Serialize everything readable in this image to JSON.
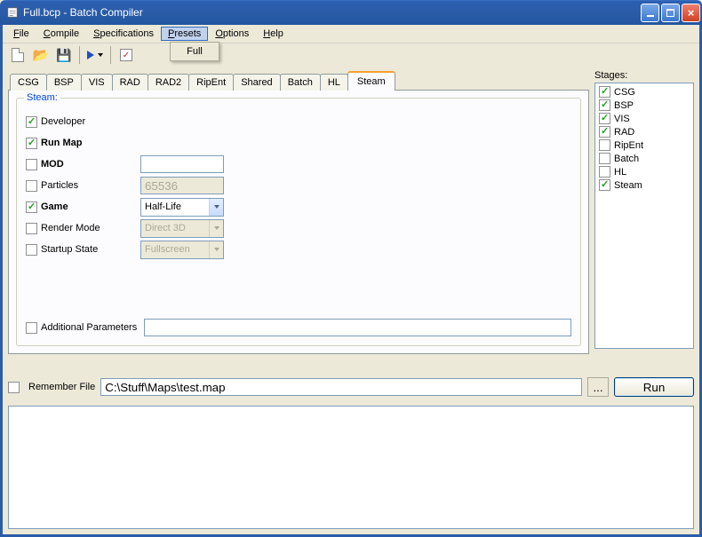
{
  "window": {
    "title": "Full.bcp - Batch Compiler"
  },
  "menubar": {
    "file": "File",
    "compile": "Compile",
    "specifications": "Specifications",
    "presets": "Presets",
    "options": "Options",
    "help": "Help"
  },
  "preset_dropdown": {
    "selected": "Full"
  },
  "tabs": [
    "CSG",
    "BSP",
    "VIS",
    "RAD",
    "RAD2",
    "RipEnt",
    "Shared",
    "Batch",
    "HL",
    "Steam"
  ],
  "active_tab": "Steam",
  "steam": {
    "group_title": "Steam:",
    "developer": {
      "label": "Developer",
      "checked": true
    },
    "run_map": {
      "label": "Run Map",
      "checked": true
    },
    "mod": {
      "label": "MOD",
      "checked": false,
      "value": ""
    },
    "particles": {
      "label": "Particles",
      "checked": false,
      "value": "65536"
    },
    "game": {
      "label": "Game",
      "checked": true,
      "value": "Half-Life"
    },
    "render_mode": {
      "label": "Render Mode",
      "checked": false,
      "value": "Direct 3D"
    },
    "startup_state": {
      "label": "Startup State",
      "checked": false,
      "value": "Fullscreen"
    },
    "additional": {
      "label": "Additional Parameters",
      "checked": false,
      "value": ""
    }
  },
  "stages": {
    "title": "Stages:",
    "items": [
      {
        "label": "CSG",
        "checked": true
      },
      {
        "label": "BSP",
        "checked": true
      },
      {
        "label": "VIS",
        "checked": true
      },
      {
        "label": "RAD",
        "checked": true
      },
      {
        "label": "RipEnt",
        "checked": false
      },
      {
        "label": "Batch",
        "checked": false
      },
      {
        "label": "HL",
        "checked": false
      },
      {
        "label": "Steam",
        "checked": true
      }
    ]
  },
  "remember_file": {
    "label": "Remember File",
    "checked": false,
    "path": "C:\\Stuff\\Maps\\test.map"
  },
  "buttons": {
    "browse": "...",
    "run": "Run"
  }
}
